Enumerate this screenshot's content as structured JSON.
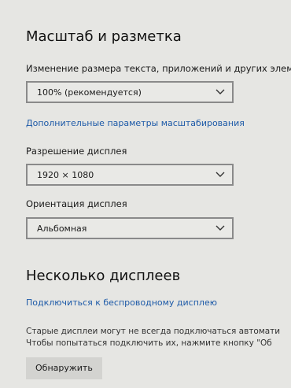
{
  "scale_layout": {
    "title": "Масштаб и разметка",
    "text_size_label": "Изменение размера текста, приложений и других элем",
    "text_size_value": "100% (рекомендуется)",
    "advanced_scaling_link": "Дополнительные параметры масштабирования",
    "resolution_label": "Разрешение дисплея",
    "resolution_value": "1920 × 1080",
    "orientation_label": "Ориентация дисплея",
    "orientation_value": "Альбомная"
  },
  "multiple_displays": {
    "title": "Несколько дисплеев",
    "wireless_link": "Подключиться к беспроводному дисплею",
    "description_line1": "Старые дисплеи могут не всегда подключаться автомати",
    "description_line2": "Чтобы попытаться подключить их, нажмите кнопку \"Об",
    "detect_button": "Обнаружить"
  },
  "icons": {
    "dropdown_chevron": "chevron-down-icon"
  }
}
